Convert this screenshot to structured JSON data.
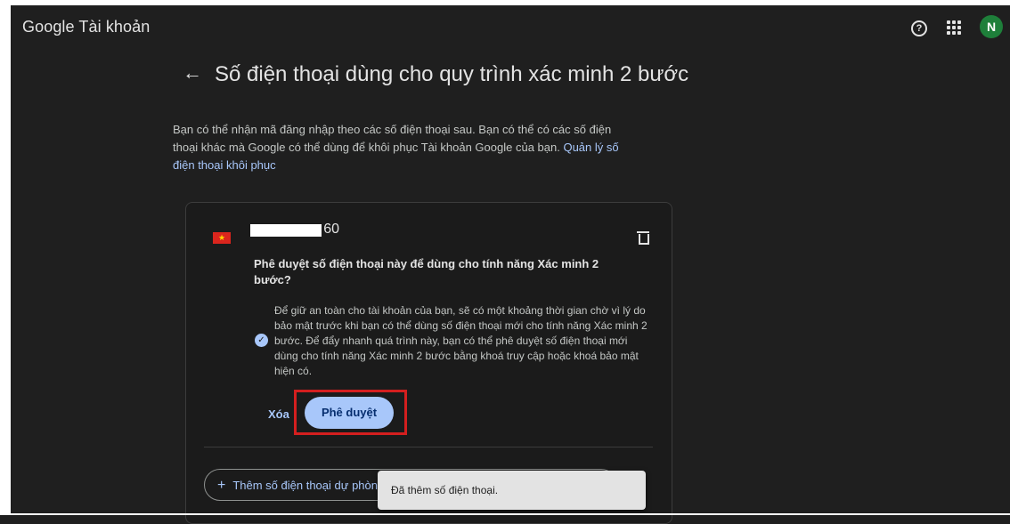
{
  "header": {
    "brand": "Google Tài khoản",
    "help_icon": "?",
    "avatar_letter": "N"
  },
  "page": {
    "back_arrow": "←",
    "title": "Số điện thoại dùng cho quy trình xác minh 2 bước",
    "intro_text": "Bạn có thể nhận mã đăng nhập theo các số điện thoại sau. Bạn có thể có các số điện thoại khác mà Google có thể dùng để khôi phục Tài khoản Google của bạn. ",
    "intro_link": "Quản lý số điện thoại khôi phục"
  },
  "card": {
    "flag_star": "★",
    "phone_suffix": "60",
    "approve_question": "Phê duyệt số điện thoại này để dùng cho tính năng Xác minh 2 bước?",
    "check_mark": "✓",
    "approve_info": "Để giữ an toàn cho tài khoản của bạn, sẽ có một khoảng thời gian chờ vì lý do bảo mật trước khi bạn có thể dùng số điện thoại mới cho tính năng Xác minh 2 bước. Để đẩy nhanh quá trình này, bạn có thể phê duyệt số điện thoại mới dùng cho tính năng Xác minh 2 bước bằng khoá truy cập hoặc khoá bảo mật hiện có.",
    "delete_label": "Xóa",
    "approve_label": "Phê duyệt",
    "add_phone_plus": "+",
    "add_phone_label": "Thêm số điện thoại dự phòng"
  },
  "snackbar": {
    "message": "Đã thêm số điện thoại."
  },
  "colors": {
    "background": "#1f1f1f",
    "accent": "#a8c7fa",
    "highlight": "#d41f1f",
    "avatar": "#1e7f3a"
  }
}
